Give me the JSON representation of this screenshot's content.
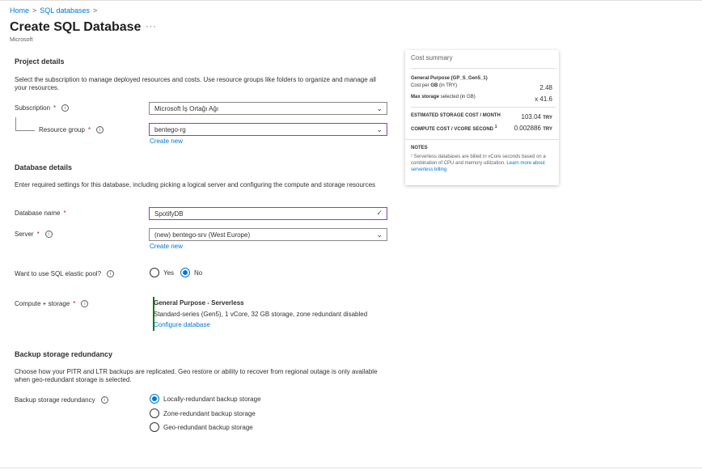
{
  "breadcrumb": {
    "home": "Home",
    "sep1": ">",
    "sql": "SQL databases",
    "sep2": ">"
  },
  "header": {
    "title": "Create SQL Database",
    "more": "···",
    "subtitle": "Microsoft"
  },
  "project": {
    "title": "Project details",
    "description": "Select the subscription to manage deployed resources and costs. Use resource groups like folders to organize and manage all your resources.",
    "subscription_label": "Subscription",
    "subscription_value": "Microsoft İş Ortağı Ağı",
    "rg_label": "Resource group",
    "rg_value": "bentego-rg",
    "rg_create": "Create new"
  },
  "database": {
    "title": "Database details",
    "description": "Enter required settings for this database, including picking a logical server and configuring the compute and storage resources",
    "name_label": "Database name",
    "name_value": "SpotifyDB",
    "server_label": "Server",
    "server_value": "(new) bentego-srv (West Europe)",
    "server_create": "Create new",
    "pool_label": "Want to use SQL elastic pool?",
    "pool_yes": "Yes",
    "pool_no": "No",
    "pool_selected": "No",
    "compute_label": "Compute + storage",
    "compute_tier": "General Purpose - Serverless",
    "compute_detail": "Standard-series (Gen5), 1 vCore, 32 GB storage, zone redundant disabled",
    "compute_link": "Configure database"
  },
  "backup": {
    "title": "Backup storage redundancy",
    "description": "Choose how your PITR and LTR backups are replicated. Geo restore or ability to recover from regional outage is only available when geo-redundant storage is selected.",
    "label": "Backup storage redundancy",
    "options": [
      "Locally-redundant backup storage",
      "Zone-redundant backup storage",
      "Geo-redundant backup storage"
    ],
    "selected": "Locally-redundant backup storage"
  },
  "summary": {
    "title": "Cost summary",
    "tier": "General Purpose (GP_S_Gen5_1)",
    "cost_per_gb_label_a": "Cost per ",
    "cost_per_gb_label_b": "GB",
    "cost_per_gb_label_c": " (in TRY)",
    "cost_per_gb": "2.48",
    "max_storage_label_a": "Max storage",
    "max_storage_label_b": " selected (in GB)",
    "max_storage": "x 41.6",
    "est_storage_label": "ESTIMATED STORAGE COST / MONTH",
    "est_storage_value": "103.04",
    "est_storage_unit": "TRY",
    "compute_cost_label": "COMPUTE COST / VCORE SECOND",
    "compute_cost_sup": "1",
    "compute_cost_value": "0.002886",
    "compute_cost_unit": "TRY",
    "notes_title": "NOTES",
    "notes_text": "¹ Serverless databases are billed in vCore seconds based on a combination of CPU and memory utilization. ",
    "notes_link": "Learn more about serverless billing"
  },
  "colors": {
    "accent": "#0078d4",
    "focus": "#8e3fb1",
    "required": "#a4262c",
    "ok": "#107c10"
  }
}
